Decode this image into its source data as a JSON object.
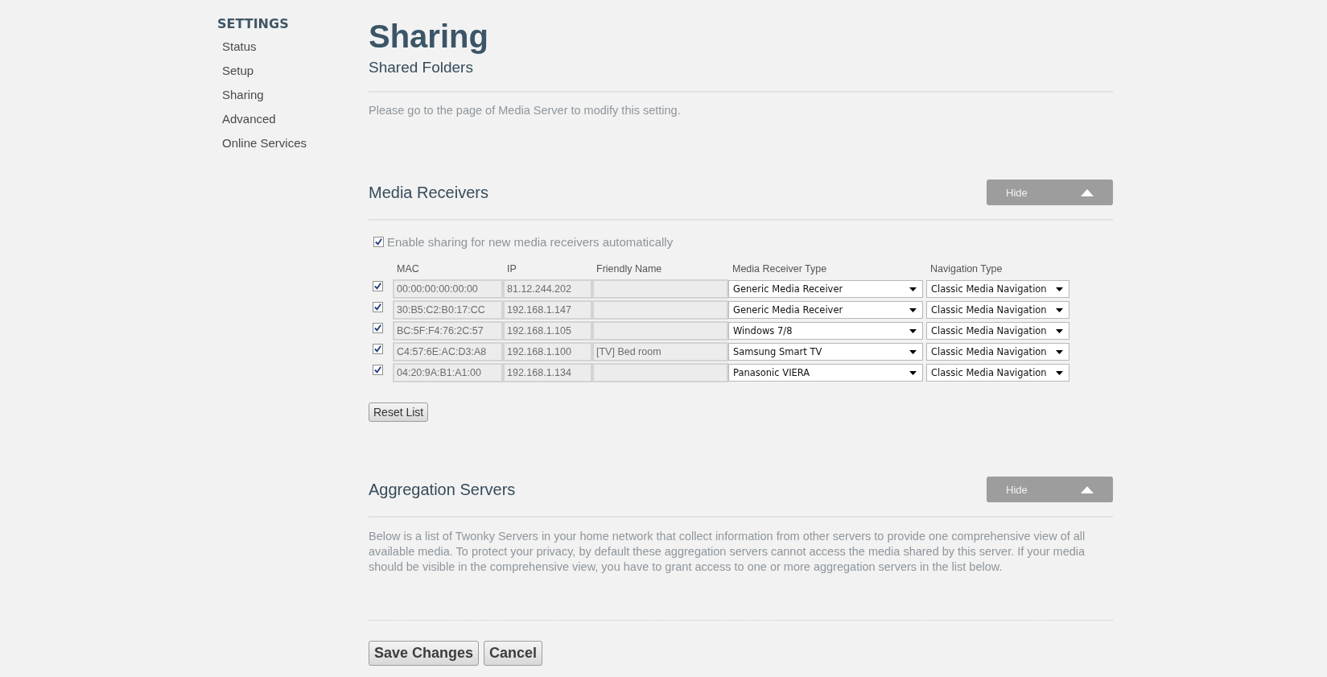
{
  "sidebar": {
    "title": "SETTINGS",
    "items": [
      {
        "label": "Status",
        "selected": false
      },
      {
        "label": "Setup",
        "selected": false
      },
      {
        "label": "Sharing",
        "selected": false
      },
      {
        "label": "Advanced",
        "selected": false
      },
      {
        "label": "Online Services",
        "selected": false
      }
    ]
  },
  "page": {
    "title": "Sharing"
  },
  "shared_folders": {
    "title": "Shared Folders",
    "note": "Please go to the page of Media Server to modify this setting."
  },
  "media_receivers": {
    "title": "Media Receivers",
    "toggle": "Hide",
    "auto_enable": {
      "label": "Enable sharing for new media receivers automatically",
      "checked": true
    },
    "columns": [
      "MAC",
      "IP",
      "Friendly Name",
      "Media Receiver Type",
      "Navigation Type"
    ],
    "rows": [
      {
        "checked": true,
        "mac": "00:00:00:00:00:00",
        "ip": "81.12.244.202",
        "friendly_name": "",
        "receiver_type": "Generic Media Receiver",
        "navigation_type": "Classic Media Navigation"
      },
      {
        "checked": true,
        "mac": "30:B5:C2:B0:17:CC",
        "ip": "192.168.1.147",
        "friendly_name": "",
        "receiver_type": "Generic Media Receiver",
        "navigation_type": "Classic Media Navigation"
      },
      {
        "checked": true,
        "mac": "BC:5F:F4:76:2C:57",
        "ip": "192.168.1.105",
        "friendly_name": "",
        "receiver_type": "Windows 7/8",
        "navigation_type": "Classic Media Navigation"
      },
      {
        "checked": true,
        "mac": "C4:57:6E:AC:D3:A8",
        "ip": "192.168.1.100",
        "friendly_name": "[TV] Bed room",
        "receiver_type": "Samsung Smart TV",
        "navigation_type": "Classic Media Navigation"
      },
      {
        "checked": true,
        "mac": "04:20:9A:B1:A1:00",
        "ip": "192.168.1.134",
        "friendly_name": "",
        "receiver_type": "Panasonic VIERA",
        "navigation_type": "Classic Media Navigation"
      }
    ],
    "reset_button": "Reset List"
  },
  "aggregation_servers": {
    "title": "Aggregation Servers",
    "toggle": "Hide",
    "description": "Below is a list of Twonky Servers in your home network that collect information from other servers to provide one comprehensive view of all available media. To protect your privacy, by default these aggregation servers cannot access the media shared by this server. If your media should be visible in the comprehensive view, you have to grant access to one or more aggregation servers in the list below."
  },
  "buttons": [
    "Save Changes",
    "Cancel"
  ]
}
